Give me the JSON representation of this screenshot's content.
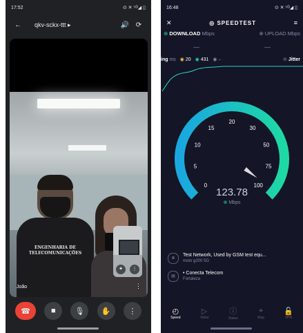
{
  "meet": {
    "status": {
      "time": "17:52",
      "right": "⊙ ✕ ⁵ᴳ◢ ▯"
    },
    "header": {
      "meeting_code": "qkv-sckx-ttt",
      "chevron": "▸"
    },
    "video": {
      "shirt_text": "ENGENHARIA DE\nTELECOMUNICAÇÕES"
    },
    "participant_name": "João",
    "controls": [
      "end-call",
      "camera",
      "mic",
      "raise-hand",
      "more"
    ]
  },
  "speedtest": {
    "status": {
      "time": "16:48",
      "right": "⊙ ✕ ⁵ᴳ◢ ▯"
    },
    "app_name": "SPEEDTEST",
    "download_label": "DOWNLOAD",
    "download_unit": "Mbps",
    "upload_label": "UPLOAD",
    "upload_unit": "Mbps",
    "download_value": "—",
    "upload_value": "—",
    "ping": {
      "label": "ing",
      "unit": "ms",
      "idle": "20",
      "download": "431",
      "upload": "–",
      "jitter_label": "Jitter"
    },
    "gauge": {
      "ticks": [
        "0",
        "5",
        "10",
        "15",
        "20",
        "30",
        "50",
        "75",
        "100"
      ],
      "value": 123.78,
      "value_text": "123.78",
      "unit": "Mbps"
    },
    "server": {
      "name": "Test Network, Used by GSM test equ...",
      "device": "moto g200 5G"
    },
    "provider": {
      "name": "Conecta Telecom",
      "city": "Fortaleza"
    },
    "nav": [
      {
        "label": "Speed",
        "icon": "speedometer-icon",
        "active": true
      },
      {
        "label": "Video",
        "icon": "play-icon",
        "active": false
      },
      {
        "label": "Status",
        "icon": "alert-icon",
        "active": false
      },
      {
        "label": "Map",
        "icon": "map-pin-icon",
        "active": false
      },
      {
        "label": "VPN",
        "icon": "lock-icon",
        "active": false
      }
    ],
    "colors": {
      "accent": "#1fd0b2",
      "gauge_start": "#1aa7e0",
      "gauge_end": "#1ed9a4",
      "background": "#141526"
    }
  }
}
